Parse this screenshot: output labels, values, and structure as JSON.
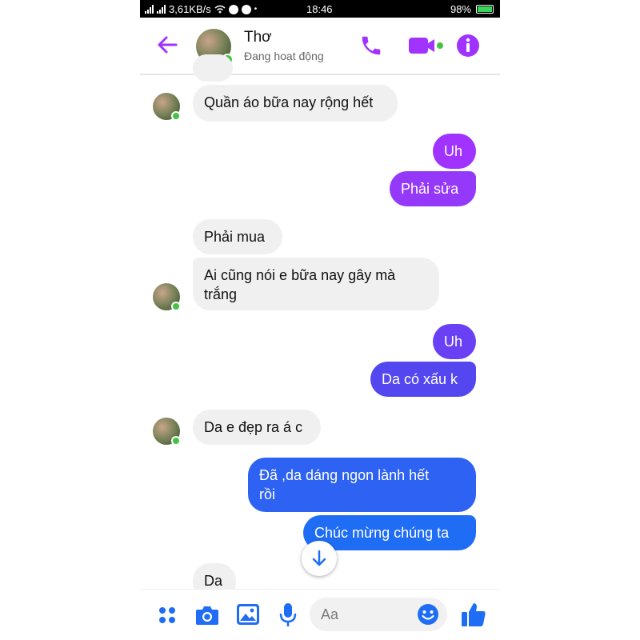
{
  "status_bar": {
    "network": "3,61KB/s",
    "time": "18:46",
    "battery": "98%",
    "battery_level": 0.98
  },
  "header": {
    "contact_name": "Thơ",
    "presence": "Đang hoạt động",
    "icons": [
      "back-arrow-icon",
      "phone-icon",
      "video-camera-icon",
      "info-icon"
    ],
    "accent_color": "#a033ff"
  },
  "messages": [
    {
      "from": "them",
      "text": "Quần áo bữa nay rộng hết"
    },
    {
      "from": "me",
      "text": "Uh"
    },
    {
      "from": "me",
      "text": "Phải sửa"
    },
    {
      "from": "them",
      "text": "Phải mua"
    },
    {
      "from": "them",
      "text": "Ai cũng nói e bữa nay gây mà trắng",
      "lines": [
        "Ai cũng nói e bữa nay gây mà",
        "trắng"
      ]
    },
    {
      "from": "me",
      "text": "Uh"
    },
    {
      "from": "me",
      "text": "Da có xấu k"
    },
    {
      "from": "them",
      "text": "Da e đẹp ra á c"
    },
    {
      "from": "me",
      "text": "Đã ,da dáng ngon lành hết rồi",
      "lines": [
        "Đã ,da dáng ngon lành hết",
        "rồi"
      ]
    },
    {
      "from": "me",
      "text": "Chúc mừng chúng ta"
    },
    {
      "from": "them",
      "text": "Da"
    }
  ],
  "composer": {
    "placeholder": "Aa",
    "icons": [
      "apps-grid-icon",
      "camera-icon",
      "gallery-icon",
      "microphone-icon",
      "emoji-icon",
      "thumbs-up-icon"
    ]
  },
  "colors": {
    "purple": "#a033ff",
    "violet": "#7a3cf0",
    "indigo": "#5447ef",
    "blue": "#1f6df5",
    "incoming": "#f0f0f0",
    "online": "#43c343"
  }
}
